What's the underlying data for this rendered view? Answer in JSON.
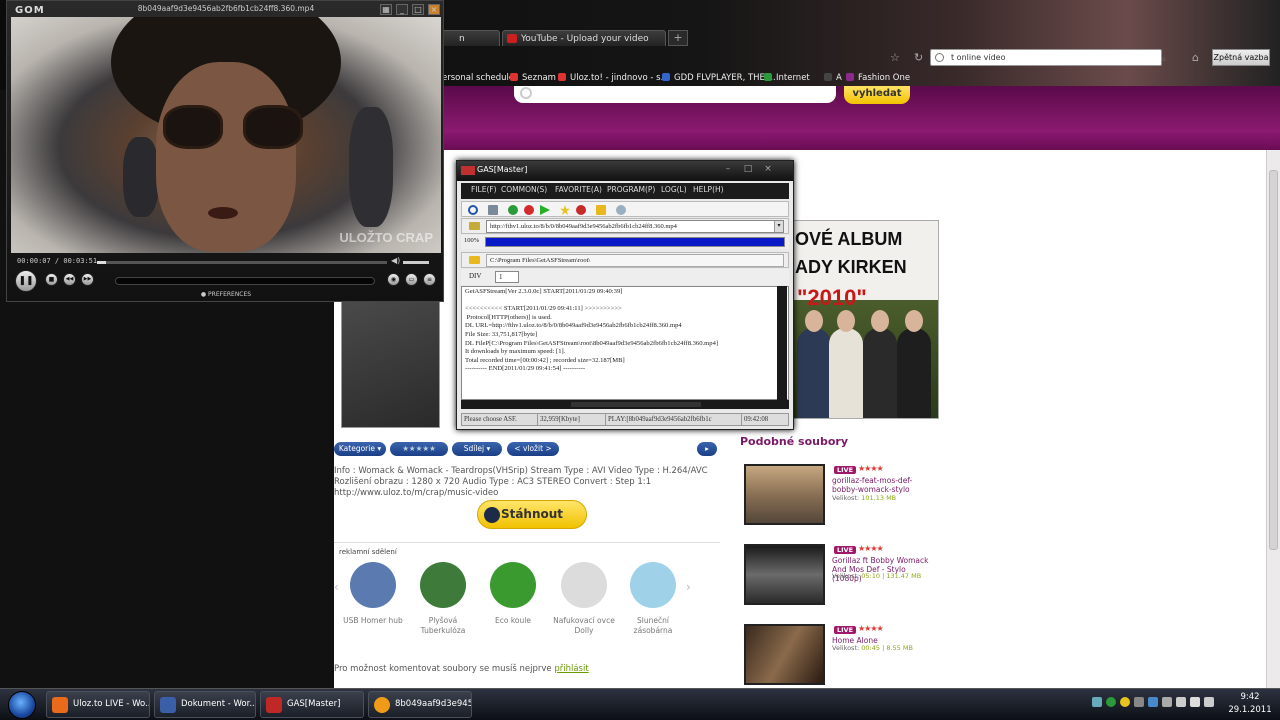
{
  "browser": {
    "tabs": [
      {
        "label": "n"
      },
      {
        "label": "YouTube - Upload your video"
      }
    ],
    "new_tab": "+",
    "search_value": "t online video",
    "feedback_button": "Zpětná vazba",
    "bookmarks": [
      "ersonal schedule",
      "Seznam",
      "Uloz.to! - jindnovo - s...",
      "GDD FLVPLAYER, THE ...",
      "Internet",
      "A",
      "Fashion One"
    ]
  },
  "site": {
    "search_button": "vyhledat",
    "pills": [
      "Kategorie ▾",
      "★★★★★",
      "Sdílej ▾",
      "< vložit >",
      "▸"
    ],
    "info_text": "Info : Womack & Womack - Teardrops(VHSrip) Stream Type : AVI Video Type : H.264/AVC Rozlišení obrazu : 1280 x 720 Audio Type : AC3 STEREO Convert : Step 1:1 http://www.uloz.to/m/crap/music-video",
    "download_button": "Stáhnout",
    "ads_label": "reklamní sdělení",
    "ads": [
      {
        "label": "USB Homer hub",
        "color": "#5a7ab0"
      },
      {
        "label": "Plyšová Tuberkulóza",
        "color": "#3e7a3a"
      },
      {
        "label": "Eco koule",
        "color": "#3b9a2f"
      },
      {
        "label": "Nafukovací ovce Dolly",
        "color": "#dcdcdc"
      },
      {
        "label": "Sluneční zásobárna",
        "color": "#9fd2e8"
      }
    ],
    "comment_text": "Pro možnost komentovat soubory se musíš nejprve ",
    "comment_link": "přihlásit",
    "album": {
      "line1": "OVÉ ALBUM",
      "line2": "ADY KIRKEN",
      "line3": "\"2010\""
    },
    "similar_title": "Podobné soubory",
    "similar": [
      {
        "badge": "LIVE",
        "stars": "★★★★",
        "title": "gorillaz-feat-mos-def-bobby-womack-stylo",
        "size_label": "Velikost:",
        "size": "101.13 MB"
      },
      {
        "badge": "LIVE",
        "stars": "★★★★",
        "title": "Gorillaz ft Bobby Womack And Mos Def - Stylo (1080p)",
        "size_label": "Velikost:",
        "size": "05:10 | 131.47 MB"
      },
      {
        "badge": "LIVE",
        "stars": "★★★★",
        "title": "Home Alone",
        "size_label": "Velikost:",
        "size": "00:45 | 8.55 MB"
      }
    ]
  },
  "gom": {
    "logo": "GOM",
    "title": "8b049aaf9d3e9456ab2fb6fb1cb24ff8.360.mp4",
    "time": "00:00:07 / 00:03:51",
    "progress": 0.03,
    "watermark": "ULOŽTO CRAP",
    "preferences": "● PREFERENCES",
    "buttons": [
      "❚❚",
      "■",
      "◀◀",
      "▶▶",
      "◉",
      "▭",
      "≡"
    ]
  },
  "gas": {
    "title": "GAS[Master]",
    "menu": [
      "FILE(F)",
      "COMMON(S)",
      "FAVORITE(A)",
      "PROGRAM(P)",
      "LOG(L)",
      "HELP(H)"
    ],
    "url": "http://fthv1.uloz.to/8/b/0/8b049aaf9d3e9456ab2fb6fb1cb24ff8.360.mp4",
    "progress_label": "100%",
    "progress": 1.0,
    "path": "C:\\Program Files\\GetASFStream\\root\\",
    "div_label": "DIV",
    "div_value": "1",
    "log": "GetASFStream[Ver 2.3.0.0c] START[2011/01/29 09:40:39]\n\n<<<<<<<<<< START[2011/01/29 09:41:11] >>>>>>>>>>\n Protocol[HTTP(others)] is used.\nDL URL=http://fthv1.uloz.to/8/b/0/8b049aaf9d3e9456ab2fb6fb1cb24ff8.360.mp4\nFile Size: 33,751,817[byte]\nDL FileP[C:\\Program Files\\GetASFStream\\root\\8b049aaf9d3e9456ab2fb6fb1cb24ff8.360.mp4]\nIt downloads by maximum speed: [1].\nTotal recorded time=[00:00:42] ; recorded size=32.187[MB]\n---------- END[2011/01/29 09:41:54] ----------",
    "status": [
      "Please choose ASF.",
      "32,959[Kbyte]",
      "PLAY:[8b049aaf9d3e9456ab2fb6fb1c",
      "09:42:08"
    ]
  },
  "taskbar": {
    "tasks": [
      {
        "label": "Uloz.to LIVE - Wo...",
        "icon_color": "#e86a1a"
      },
      {
        "label": "Dokument - Wor...",
        "icon_color": "#3a5fa8"
      },
      {
        "label": "GAS[Master]",
        "icon_color": "#c02828"
      },
      {
        "label": "8b049aaf9d3e945...",
        "icon_color": "#f09a1a"
      }
    ],
    "time": "9:42",
    "date": "29.1.2011"
  }
}
